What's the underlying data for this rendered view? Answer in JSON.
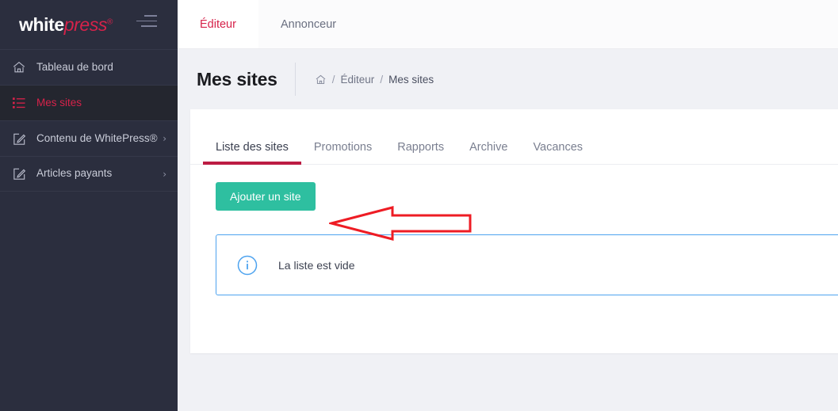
{
  "brand": {
    "name_part1": "white",
    "name_part2": "press",
    "registered": "®",
    "menu_icon": "hamburger-menu-icon"
  },
  "sidebar": {
    "items": [
      {
        "label": "Tableau de bord",
        "icon": "home-icon",
        "active": false,
        "has_chevron": false,
        "chevron": ""
      },
      {
        "label": "Mes sites",
        "icon": "list-icon",
        "active": true,
        "has_chevron": false,
        "chevron": ""
      },
      {
        "label": "Contenu de WhitePress®",
        "icon": "edit-square-icon",
        "active": false,
        "has_chevron": true,
        "chevron": "›"
      },
      {
        "label": "Articles payants",
        "icon": "edit-square-icon",
        "active": false,
        "has_chevron": true,
        "chevron": "›"
      }
    ]
  },
  "topbar": {
    "tabs": [
      {
        "label": "Éditeur",
        "active": true
      },
      {
        "label": "Annonceur",
        "active": false
      }
    ]
  },
  "page": {
    "title": "Mes sites",
    "breadcrumb": {
      "home_icon": "home-icon",
      "separator": "/",
      "items": [
        {
          "label": "Éditeur",
          "current": false
        },
        {
          "label": "Mes sites",
          "current": true
        }
      ]
    }
  },
  "card": {
    "tabs": [
      {
        "label": "Liste des sites",
        "active": true
      },
      {
        "label": "Promotions",
        "active": false
      },
      {
        "label": "Rapports",
        "active": false
      },
      {
        "label": "Archive",
        "active": false
      },
      {
        "label": "Vacances",
        "active": false
      }
    ],
    "add_site_button": "Ajouter un site",
    "alert": {
      "icon": "info-circle-icon",
      "text": "La liste est vide"
    }
  },
  "annotation": {
    "shape": "left-arrow-annotation",
    "color": "#ee1c24"
  },
  "colors": {
    "sidebar_bg": "#2b2e3e",
    "sidebar_active_bg": "#24262f",
    "brand_accent": "#d6224a",
    "tab_underline": "#bc1c43",
    "button_green": "#2ebfa0",
    "info_blue": "#4da3ef",
    "page_bg": "#f0f1f5"
  }
}
